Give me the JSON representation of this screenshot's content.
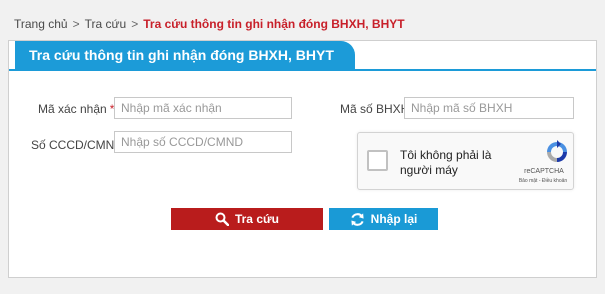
{
  "breadcrumb": {
    "home": "Trang chủ",
    "sep1": ">",
    "parent": "Tra cứu",
    "sep2": ">",
    "current": "Tra cứu thông tin ghi nhận đóng BHXH, BHYT"
  },
  "panel": {
    "title": "Tra cứu thông tin ghi nhận đóng BHXH, BHYT"
  },
  "form": {
    "confirm_code_label": "Mã xác nhận",
    "required_mark": "*",
    "confirm_code_placeholder": "Nhập mã xác nhận",
    "cccd_label": "Số CCCD/CMND",
    "cccd_placeholder": "Nhập số CCCD/CMND",
    "bhxh_label": "Mã số BHXH",
    "bhxh_placeholder": "Nhập  mã số BHXH"
  },
  "captcha": {
    "text": "Tôi không phải là người máy",
    "brand": "reCAPTCHA",
    "terms": "Bảo mật - Điều khoản"
  },
  "buttons": {
    "search": "Tra cứu",
    "reset": "Nhập lại"
  },
  "colors": {
    "accent_blue": "#1c9bd8",
    "accent_red": "#b91c1c",
    "breadcrumb_current": "#c8202a"
  }
}
